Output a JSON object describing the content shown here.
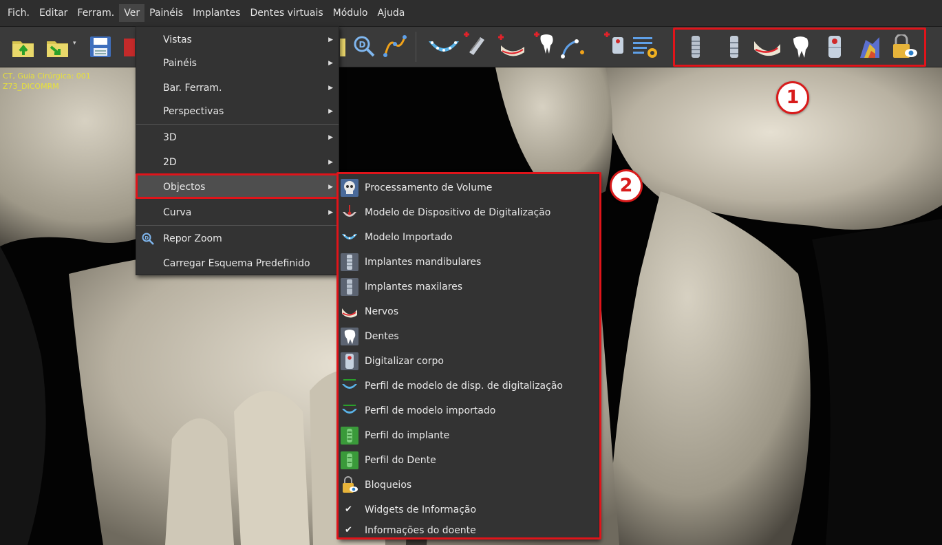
{
  "menubar": {
    "items": [
      "Fich.",
      "Editar",
      "Ferram.",
      "Ver",
      "Painéis",
      "Implantes",
      "Dentes virtuais",
      "Módulo",
      "Ajuda"
    ],
    "active": "Ver"
  },
  "toolbar": {
    "left_icons": [
      "open-folder-icon",
      "import-folder-icon",
      "save-icon",
      "close-document-icon"
    ],
    "middle_icons": [
      "reset-zoom-icon",
      "curve-draw-icon",
      "arch-model-icon",
      "add-implant-icon",
      "add-nerve-icon",
      "add-tooth-icon",
      "add-curve-point-icon",
      "add-scanbody-icon",
      "settings-list-icon"
    ],
    "right_icons": [
      "mandibular-implant-icon",
      "maxillary-implant-icon",
      "nerve-icon",
      "tooth-icon",
      "scanbody-icon",
      "volume-render-icon",
      "lock-eye-icon"
    ]
  },
  "viewport": {
    "label_line1": "CT, Guia Cirúrgica: 001",
    "label_line2": "Z73_DICOMRM"
  },
  "ver_menu": {
    "items": [
      {
        "label": "Vistas",
        "submenu": true
      },
      {
        "label": "Painéis",
        "submenu": true
      },
      {
        "label": "Bar. Ferram.",
        "submenu": true
      },
      {
        "label": "Perspectivas",
        "submenu": true
      },
      {
        "label": "3D",
        "submenu": true
      },
      {
        "label": "2D",
        "submenu": true
      },
      {
        "label": "Objectos",
        "submenu": true
      },
      {
        "label": "Curva",
        "submenu": true
      },
      {
        "label": "Repor Zoom",
        "submenu": false
      },
      {
        "label": "Carregar Esquema Predefinido",
        "submenu": false
      }
    ],
    "arrow_glyph": "▶"
  },
  "objectos_menu": {
    "items": [
      {
        "label": "Processamento de Volume",
        "icon": "skull-icon"
      },
      {
        "label": "Modelo de Dispositivo de Digitalização",
        "icon": "scan-device-icon"
      },
      {
        "label": "Modelo Importado",
        "icon": "imported-model-icon"
      },
      {
        "label": "Implantes mandibulares",
        "icon": "mandibular-implant-icon"
      },
      {
        "label": "Implantes maxilares",
        "icon": "maxillary-implant-icon"
      },
      {
        "label": "Nervos",
        "icon": "nerve-icon"
      },
      {
        "label": "Dentes",
        "icon": "tooth-icon"
      },
      {
        "label": "Digitalizar corpo",
        "icon": "scanbody-icon"
      },
      {
        "label": "Perfil de modelo de disp. de digitalização",
        "icon": "scan-profile-icon"
      },
      {
        "label": "Perfil de modelo importado",
        "icon": "imported-profile-icon"
      },
      {
        "label": "Perfil do implante",
        "icon": "implant-profile-icon"
      },
      {
        "label": "Perfil do Dente",
        "icon": "tooth-profile-icon"
      },
      {
        "label": "Bloqueios",
        "icon": "lock-icon"
      },
      {
        "label": "Widgets de Informação",
        "checked": true
      },
      {
        "label": "Informações do doente",
        "checked": true
      }
    ],
    "check_glyph": "✔"
  },
  "annotations": {
    "badge_1": "1",
    "badge_2": "2",
    "highlight_color": "#e0141a"
  }
}
